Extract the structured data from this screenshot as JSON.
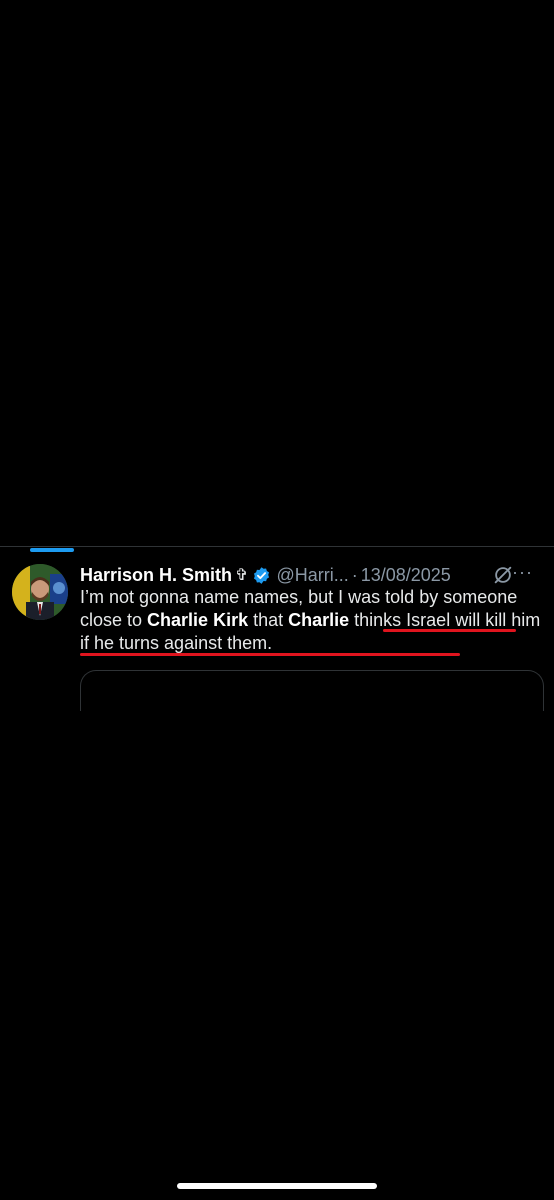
{
  "tweet": {
    "display_name": "Harrison H. Smith",
    "name_emoji": "✞",
    "handle": "@Harri...",
    "separator": "·",
    "date": "13/08/2025",
    "more": "···",
    "text_segments": [
      "I’m not gonna name names, but I was told by someone close to ",
      "Charlie Kirk",
      " that ",
      "Charlie",
      " thinks Israel will kill him if he turns against them."
    ]
  },
  "colors": {
    "background": "#000000",
    "accent_blue": "#1d9bf0",
    "underline_red": "#e0141e",
    "secondary_text": "#8b98a5"
  },
  "icons": [
    "verified-badge-icon",
    "grok-icon",
    "more-icon"
  ]
}
